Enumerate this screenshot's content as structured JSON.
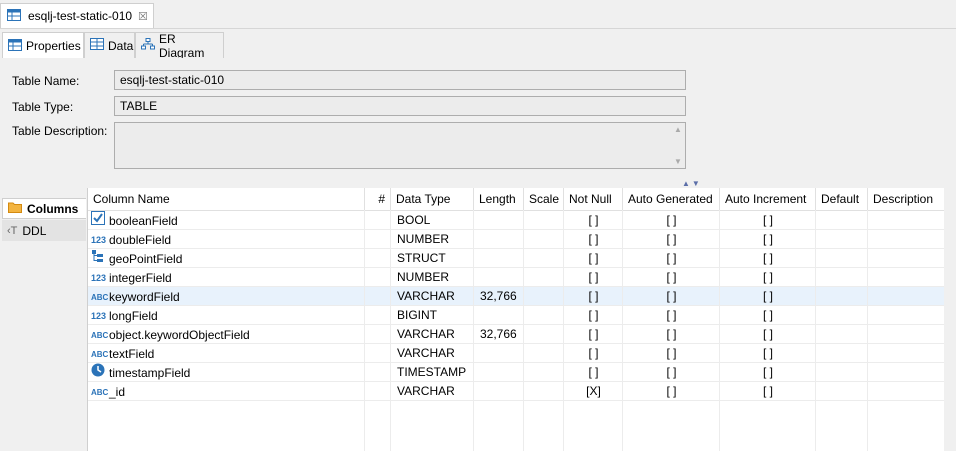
{
  "editor": {
    "tab_title": "esqlj-test-static-010",
    "close_glyph": "☒"
  },
  "subtabs": [
    {
      "label": "Properties",
      "icon": "table-icon"
    },
    {
      "label": "Data",
      "icon": "data-grid-icon"
    },
    {
      "label": "ER Diagram",
      "icon": "er-diagram-icon"
    }
  ],
  "properties": {
    "name_label": "Table Name:",
    "name_value": "esqlj-test-static-010",
    "type_label": "Table Type:",
    "type_value": "TABLE",
    "desc_label": "Table Description:",
    "desc_value": ""
  },
  "nav": [
    {
      "label": "Columns",
      "icon": "folder-icon"
    },
    {
      "label": "DDL",
      "icon": "ddl-icon"
    }
  ],
  "columns_table": {
    "headers": [
      "Column Name",
      "#",
      "Data Type",
      "Length",
      "Scale",
      "Not Null",
      "Auto Generated",
      "Auto Increment",
      "Default",
      "Description"
    ],
    "rows": [
      {
        "name": "booleanField",
        "icon": "boolean-icon",
        "type": "BOOL",
        "length": "",
        "not_null": "[ ]",
        "auto_gen": "[ ]",
        "auto_inc": "[ ]"
      },
      {
        "name": "doubleField",
        "icon": "number-icon",
        "type": "NUMBER",
        "length": "",
        "not_null": "[ ]",
        "auto_gen": "[ ]",
        "auto_inc": "[ ]"
      },
      {
        "name": "geoPointField",
        "icon": "struct-icon",
        "type": "STRUCT",
        "length": "",
        "not_null": "[ ]",
        "auto_gen": "[ ]",
        "auto_inc": "[ ]"
      },
      {
        "name": "integerField",
        "icon": "number-icon",
        "type": "NUMBER",
        "length": "",
        "not_null": "[ ]",
        "auto_gen": "[ ]",
        "auto_inc": "[ ]"
      },
      {
        "name": "keywordField",
        "icon": "text-icon",
        "type": "VARCHAR",
        "length": "32,766",
        "not_null": "[ ]",
        "auto_gen": "[ ]",
        "auto_inc": "[ ]"
      },
      {
        "name": "longField",
        "icon": "number-icon",
        "type": "BIGINT",
        "length": "",
        "not_null": "[ ]",
        "auto_gen": "[ ]",
        "auto_inc": "[ ]"
      },
      {
        "name": "object.keywordObjectField",
        "icon": "text-icon",
        "type": "VARCHAR",
        "length": "32,766",
        "not_null": "[ ]",
        "auto_gen": "[ ]",
        "auto_inc": "[ ]"
      },
      {
        "name": "textField",
        "icon": "text-icon",
        "type": "VARCHAR",
        "length": "",
        "not_null": "[ ]",
        "auto_gen": "[ ]",
        "auto_inc": "[ ]"
      },
      {
        "name": "timestampField",
        "icon": "clock-icon",
        "type": "TIMESTAMP",
        "length": "",
        "not_null": "[ ]",
        "auto_gen": "[ ]",
        "auto_inc": "[ ]"
      },
      {
        "name": "_id",
        "icon": "text-icon",
        "type": "VARCHAR",
        "length": "",
        "not_null": "[X]",
        "auto_gen": "[ ]",
        "auto_inc": "[ ]"
      }
    ],
    "selected_row": 4
  },
  "colors": {
    "accent": "#2a6fb5",
    "selection": "#e8f2fc",
    "icon_blue": "#2b73b8",
    "folder": "#f0a030"
  }
}
